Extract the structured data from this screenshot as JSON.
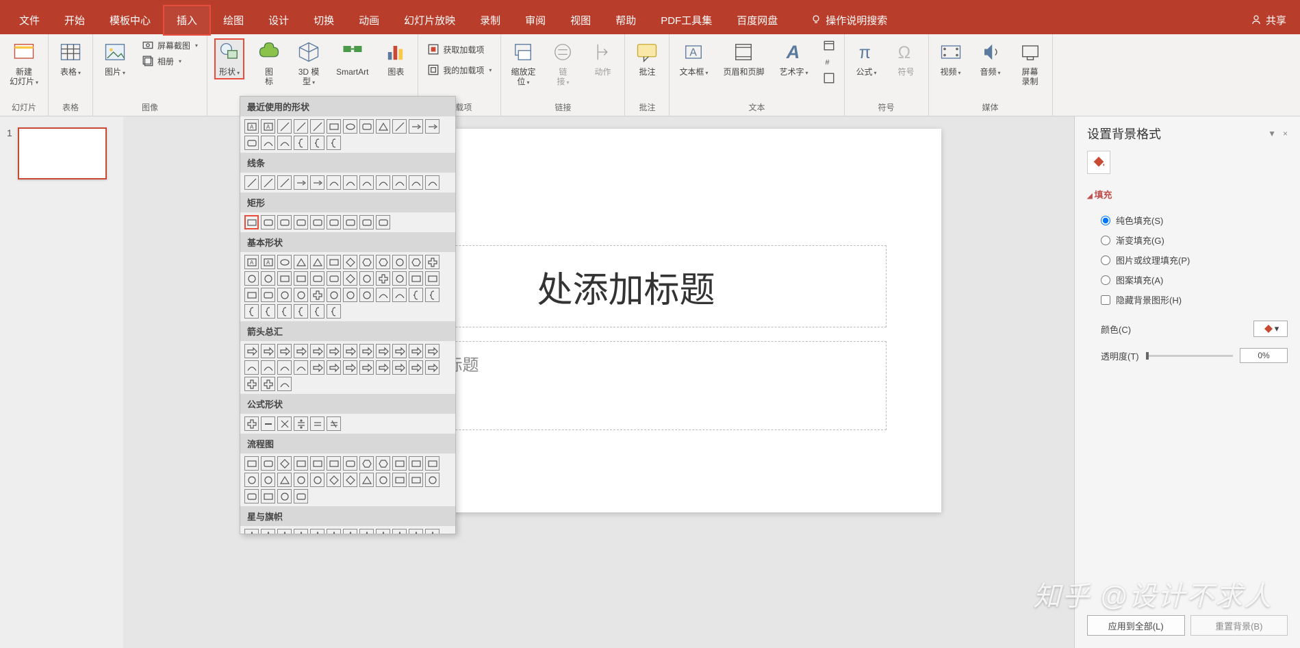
{
  "tabs": {
    "file": "文件",
    "home": "开始",
    "template": "模板中心",
    "insert": "插入",
    "draw": "绘图",
    "design": "设计",
    "transition": "切换",
    "animation": "动画",
    "slideshow": "幻灯片放映",
    "record": "录制",
    "review": "审阅",
    "view": "视图",
    "help": "帮助",
    "pdf": "PDF工具集",
    "baidu": "百度网盘",
    "tellme": "操作说明搜索",
    "share": "共享"
  },
  "ribbon": {
    "slides": {
      "new_slide": "新建\n幻灯片",
      "group": "幻灯片"
    },
    "tables": {
      "table": "表格",
      "group": "表格"
    },
    "images": {
      "picture": "图片",
      "screenshot": "屏幕截图",
      "album": "相册",
      "group": "图像"
    },
    "illustrations": {
      "shapes": "形状",
      "icons": "图\n标",
      "model3d": "3D 模\n型",
      "smartart": "SmartArt",
      "chart": "图表"
    },
    "addins": {
      "get": "获取加载项",
      "my": "我的加载项",
      "group": "加载项"
    },
    "links": {
      "zoom": "缩放定\n位",
      "link": "链\n接",
      "action": "动作",
      "group": "链接"
    },
    "comments": {
      "comment": "批注",
      "group": "批注"
    },
    "text": {
      "textbox": "文本框",
      "header": "页眉和页脚",
      "wordart": "艺术字",
      "group": "文本"
    },
    "symbols": {
      "equation": "公式",
      "symbol": "符号",
      "group": "符号"
    },
    "media": {
      "video": "视频",
      "audio": "音频",
      "screen_rec": "屏幕\n录制",
      "group": "媒体"
    }
  },
  "shapes_menu": {
    "recent": "最近使用的形状",
    "lines": "线条",
    "rectangles": "矩形",
    "basic": "基本形状",
    "arrows": "箭头总汇",
    "equation": "公式形状",
    "flowchart": "流程图",
    "stars": "星与旗帜"
  },
  "slide": {
    "number": "1",
    "title_placeholder": "处添加标题",
    "subtitle_placeholder": "处添加副标题"
  },
  "panel": {
    "title": "设置背景格式",
    "fill": "填充",
    "solid": "纯色填充(S)",
    "gradient": "渐变填充(G)",
    "picture": "图片或纹理填充(P)",
    "pattern": "图案填充(A)",
    "hide_bg": "隐藏背景图形(H)",
    "color": "颜色(C)",
    "transparency": "透明度(T)",
    "transparency_val": "0%",
    "apply_all": "应用到全部(L)",
    "reset": "重置背景(B)"
  },
  "watermark": "知乎 @设计不求人"
}
